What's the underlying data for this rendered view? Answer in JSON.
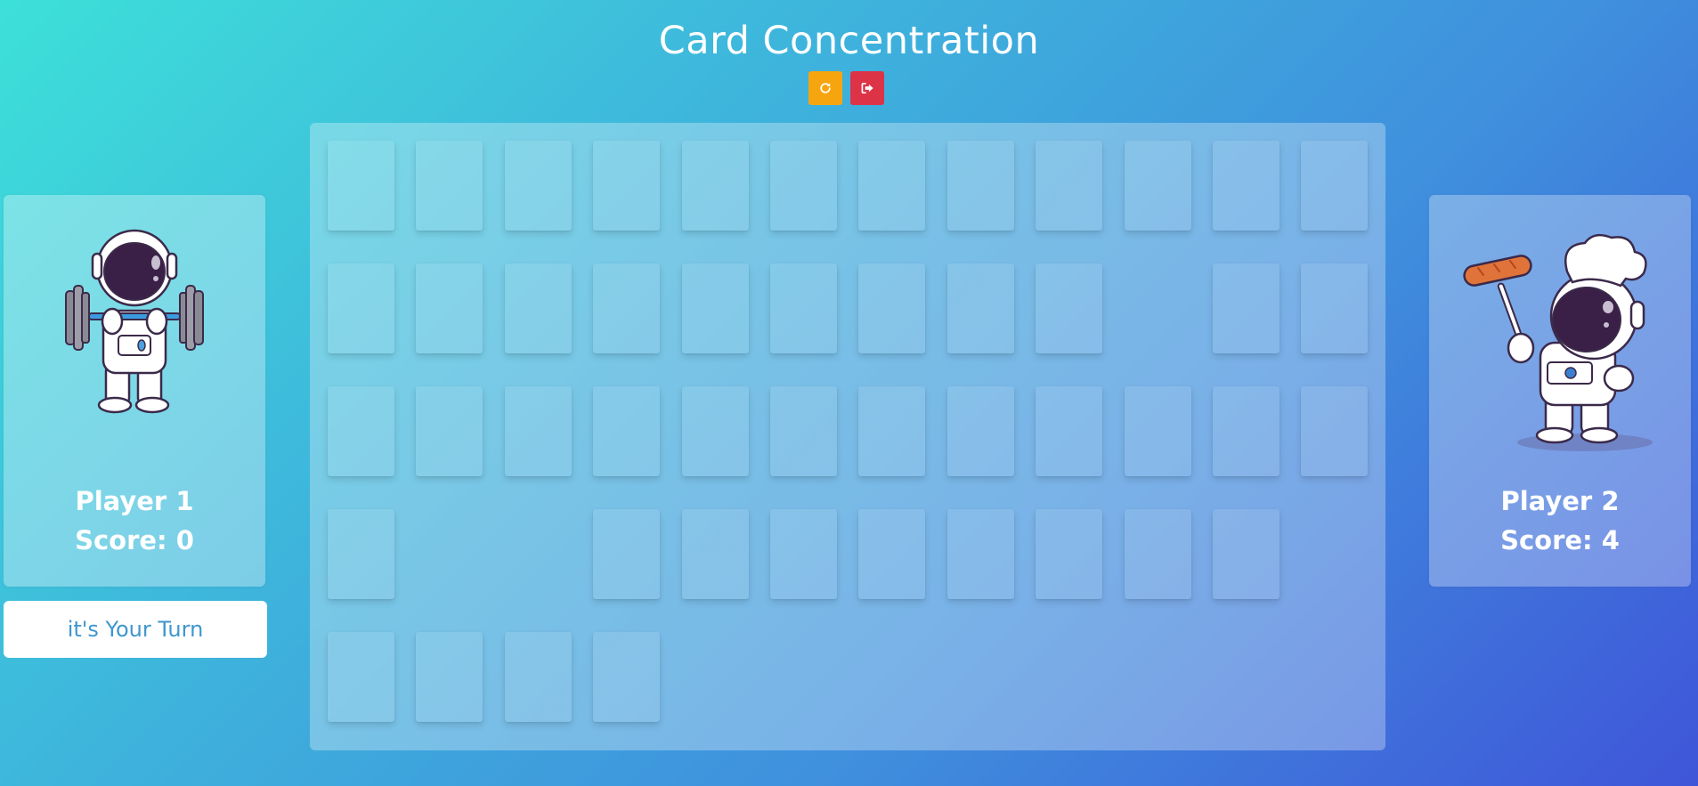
{
  "title": "Card Concentration",
  "controls": {
    "restart_icon": "restart-icon",
    "exit_icon": "exit-icon",
    "restart_color": "#f7a50f",
    "exit_color": "#dd3347"
  },
  "players": [
    {
      "name": "Player 1",
      "score": "Score: 0",
      "avatar": "astronaut-lifting-barbell"
    },
    {
      "name": "Player 2",
      "score": "Score: 4",
      "avatar": "astronaut-chef-with-sausage"
    }
  ],
  "turn_message": "it's Your Turn",
  "board": {
    "columns": 12,
    "rows": [
      [
        1,
        1,
        1,
        1,
        1,
        1,
        1,
        1,
        1,
        1,
        1,
        1
      ],
      [
        1,
        1,
        1,
        1,
        1,
        1,
        1,
        1,
        1,
        0,
        1,
        1
      ],
      [
        1,
        1,
        1,
        1,
        1,
        1,
        1,
        1,
        1,
        1,
        1,
        1
      ],
      [
        1,
        0,
        0,
        1,
        1,
        1,
        1,
        1,
        1,
        1,
        1,
        0
      ],
      [
        1,
        1,
        1,
        1,
        0,
        0,
        0,
        0,
        0,
        0,
        0,
        0
      ]
    ]
  }
}
